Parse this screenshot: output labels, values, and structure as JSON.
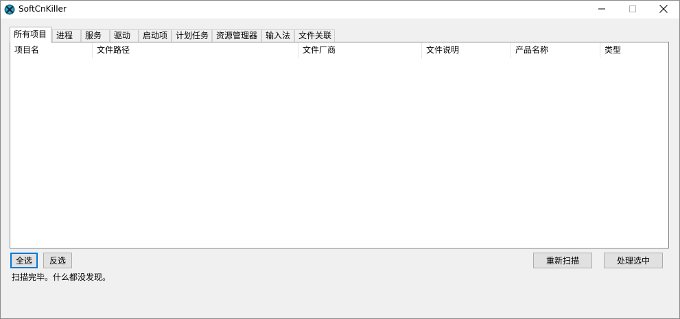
{
  "window": {
    "title": "SoftCnKiller",
    "icons": {
      "app": "softcnkiller-app-icon",
      "minimize": "minimize-icon",
      "maximize": "maximize-icon",
      "close": "close-icon"
    }
  },
  "tabs": [
    {
      "label": "所有项目",
      "active": true
    },
    {
      "label": "进程"
    },
    {
      "label": "服务"
    },
    {
      "label": "驱动"
    },
    {
      "label": "启动项"
    },
    {
      "label": "计划任务"
    },
    {
      "label": "资源管理器"
    },
    {
      "label": "输入法"
    },
    {
      "label": "文件关联"
    }
  ],
  "list": {
    "columns": [
      "项目名",
      "文件路径",
      "文件厂商",
      "文件说明",
      "产品名称",
      "类型"
    ],
    "rows": []
  },
  "buttons": {
    "select_all": "全选",
    "invert": "反选",
    "rescan": "重新扫描",
    "process_selected": "处理选中"
  },
  "status": "扫描完毕。什么都没发现。",
  "colors": {
    "focus_border": "#0078d7",
    "list_border": "#828790",
    "window_bg": "#f0f0f0"
  }
}
